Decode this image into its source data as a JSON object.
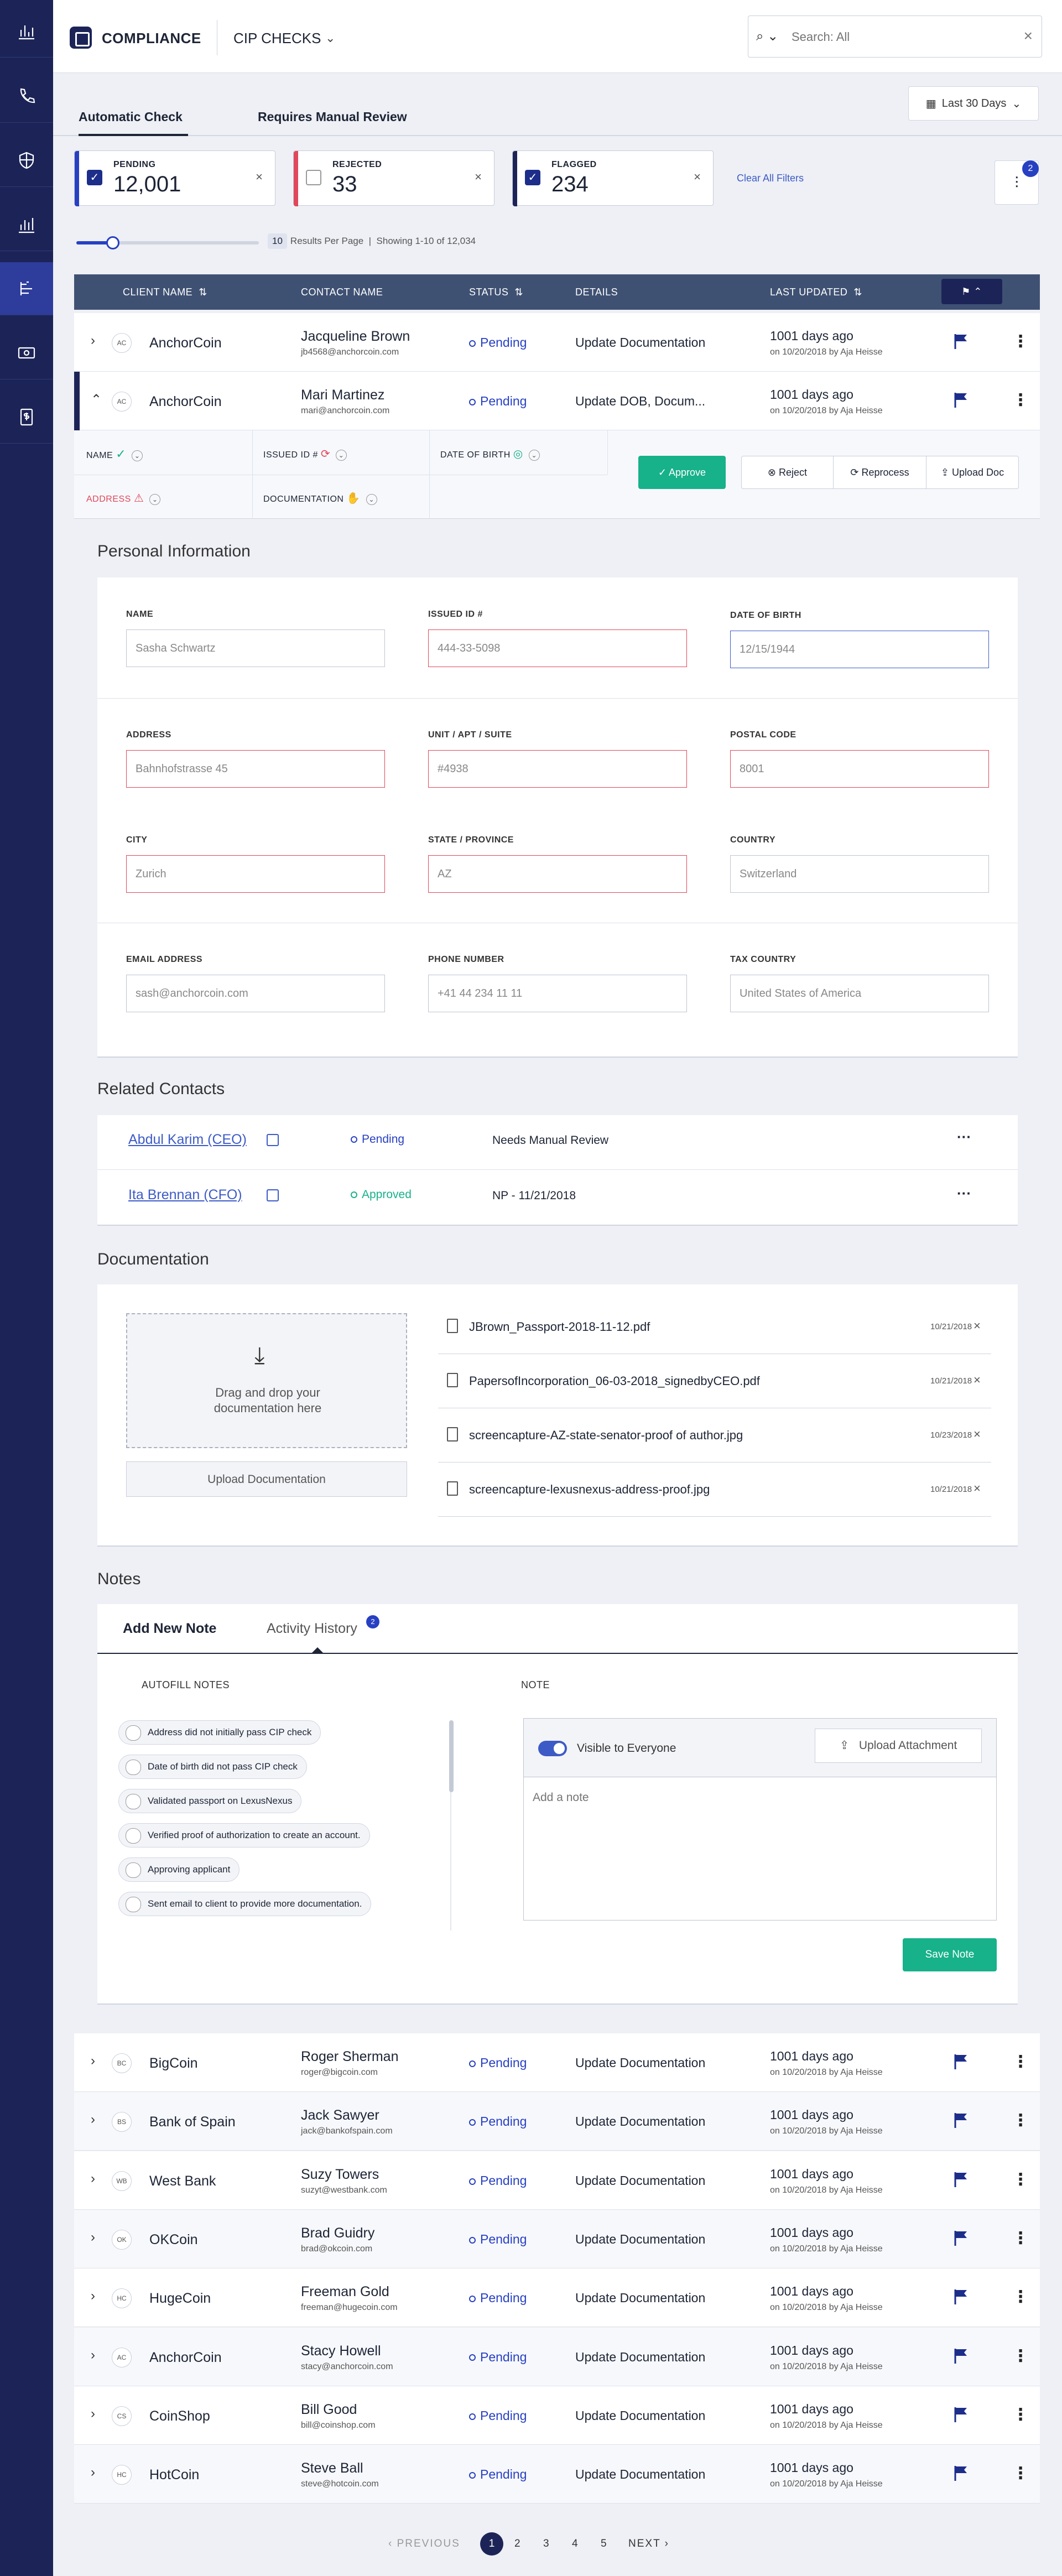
{
  "app": {
    "title": "COMPLIANCE",
    "module": "CIP CHECKS"
  },
  "search": {
    "placeholder": "Search: All"
  },
  "date_range": "Last 30 Days",
  "tabs": [
    {
      "label": "Automatic Check"
    },
    {
      "label": "Requires Manual Review"
    }
  ],
  "filters": [
    {
      "label": "PENDING",
      "count": "12,001",
      "checked": true,
      "color": "#2740c2"
    },
    {
      "label": "REJECTED",
      "count": "33",
      "checked": false,
      "color": "#e0475a"
    },
    {
      "label": "FLAGGED",
      "count": "234",
      "checked": true,
      "color": "#1c2457"
    }
  ],
  "clear_filters": "Clear All Filters",
  "filter_badge": "2",
  "pagination_info": {
    "per_page_value": 0.13,
    "per_page": "10",
    "label": "Results Per Page",
    "showing": "Showing 1-10 of 12,034"
  },
  "columns": {
    "client": "CLIENT NAME",
    "contact": "CONTACT NAME",
    "status": "STATUS",
    "details": "DETAILS",
    "updated": "LAST UPDATED"
  },
  "rows_top": [
    {
      "initials": "AC",
      "client": "AnchorCoin",
      "contact": "Jacqueline Brown",
      "email": "jb4568@anchorcoin.com",
      "status": "Pending",
      "details": "Update Documentation",
      "updated": "1001 days ago",
      "updated_by": "on 10/20/2018 by Aja Heisse"
    },
    {
      "initials": "AC",
      "client": "AnchorCoin",
      "contact": "Mari Martinez",
      "email": "mari@anchorcoin.com",
      "status": "Pending",
      "details": "Update DOB, Docum...",
      "updated": "1001 days ago",
      "updated_by": "on 10/20/2018 by Aja Heisse"
    }
  ],
  "checks": {
    "name": "NAME",
    "issued_id": "ISSUED ID #",
    "dob": "DATE OF BIRTH",
    "address": "ADDRESS",
    "documentation": "DOCUMENTATION",
    "approve": "Approve",
    "reject": "Reject",
    "reprocess": "Reprocess",
    "upload_doc": "Upload Doc"
  },
  "personal_info": {
    "title": "Personal Information",
    "fields": {
      "name": {
        "label": "NAME",
        "value": "Sasha Schwartz"
      },
      "issued_id": {
        "label": "ISSUED ID #",
        "value": "444-33-5098"
      },
      "dob": {
        "label": "DATE OF BIRTH",
        "value": "12/15/1944"
      },
      "address": {
        "label": "ADDRESS",
        "value": "Bahnhofstrasse 45"
      },
      "unit": {
        "label": "UNIT / APT / SUITE",
        "value": "#4938"
      },
      "postal": {
        "label": "POSTAL CODE",
        "value": "8001"
      },
      "city": {
        "label": "CITY",
        "value": "Zurich"
      },
      "state": {
        "label": "STATE / PROVINCE",
        "value": "AZ"
      },
      "country": {
        "label": "COUNTRY",
        "value": "Switzerland"
      },
      "email": {
        "label": "EMAIL ADDRESS",
        "value": "sash@anchorcoin.com"
      },
      "phone": {
        "label": "PHONE NUMBER",
        "value": "+41 44 234 11 11"
      },
      "tax_country": {
        "label": "TAX COUNTRY",
        "value": "United States of America"
      }
    }
  },
  "related_contacts": {
    "title": "Related Contacts",
    "items": [
      {
        "name": "Abdul Karim (CEO)",
        "status": "Pending",
        "note": "Needs Manual Review"
      },
      {
        "name": "Ita Brennan (CFO)",
        "status": "Approved",
        "note": "NP - 11/21/2018"
      }
    ]
  },
  "documentation": {
    "title": "Documentation",
    "drop_text_1": "Drag and drop your",
    "drop_text_2": "documentation here",
    "upload": "Upload Documentation",
    "files": [
      {
        "name": "JBrown_Passport-2018-11-12.pdf",
        "date": "10/21/2018"
      },
      {
        "name": "PapersofIncorporation_06-03-2018_signedbyCEO.pdf",
        "date": "10/21/2018"
      },
      {
        "name": "screencapture-AZ-state-senator-proof of author.jpg",
        "date": "10/23/2018"
      },
      {
        "name": "screencapture-lexusnexus-address-proof.jpg",
        "date": "10/21/2018"
      }
    ]
  },
  "notes": {
    "title": "Notes",
    "tab_add": "Add New Note",
    "tab_history": "Activity History",
    "history_badge": "2",
    "autofill_label": "AUTOFILL NOTES",
    "note_label": "NOTE",
    "autofill": [
      "Address did not initially pass CIP check",
      "Date of birth did not pass CIP check",
      "Validated passport on LexusNexus",
      "Verified proof of authorization to create an account.",
      "Approving applicant",
      "Sent email to client to provide more documentation."
    ],
    "visible_label": "Visible to Everyone",
    "upload_attachment": "Upload Attachment",
    "placeholder": "Add a note",
    "save": "Save Note"
  },
  "rows_bottom": [
    {
      "initials": "BC",
      "client": "BigCoin",
      "contact": "Roger Sherman",
      "email": "roger@bigcoin.com",
      "status": "Pending",
      "details": "Update Documentation",
      "updated": "1001 days ago",
      "updated_by": "on 10/20/2018 by Aja Heisse"
    },
    {
      "initials": "BS",
      "client": "Bank of Spain",
      "contact": "Jack Sawyer",
      "email": "jack@bankofspain.com",
      "status": "Pending",
      "details": "Update Documentation",
      "updated": "1001 days ago",
      "updated_by": "on 10/20/2018 by Aja Heisse"
    },
    {
      "initials": "WB",
      "client": "West Bank",
      "contact": "Suzy Towers",
      "email": "suzyt@westbank.com",
      "status": "Pending",
      "details": "Update Documentation",
      "updated": "1001 days ago",
      "updated_by": "on 10/20/2018 by Aja Heisse"
    },
    {
      "initials": "OK",
      "client": "OKCoin",
      "contact": "Brad Guidry",
      "email": "brad@okcoin.com",
      "status": "Pending",
      "details": "Update Documentation",
      "updated": "1001 days ago",
      "updated_by": "on 10/20/2018 by Aja Heisse"
    },
    {
      "initials": "HC",
      "client": "HugeCoin",
      "contact": "Freeman Gold",
      "email": "freeman@hugecoin.com",
      "status": "Pending",
      "details": "Update Documentation",
      "updated": "1001 days ago",
      "updated_by": "on 10/20/2018 by Aja Heisse"
    },
    {
      "initials": "AC",
      "client": "AnchorCoin",
      "contact": "Stacy Howell",
      "email": "stacy@anchorcoin.com",
      "status": "Pending",
      "details": "Update Documentation",
      "updated": "1001 days ago",
      "updated_by": "on 10/20/2018 by Aja Heisse"
    },
    {
      "initials": "CS",
      "client": "CoinShop",
      "contact": "Bill Good",
      "email": "bill@coinshop.com",
      "status": "Pending",
      "details": "Update Documentation",
      "updated": "1001 days ago",
      "updated_by": "on 10/20/2018 by Aja Heisse"
    },
    {
      "initials": "HC",
      "client": "HotCoin",
      "contact": "Steve Ball",
      "email": "steve@hotcoin.com",
      "status": "Pending",
      "details": "Update Documentation",
      "updated": "1001 days ago",
      "updated_by": "on 10/20/2018 by Aja Heisse"
    }
  ],
  "pager": {
    "prev": "PREVIOUS",
    "next": "NEXT",
    "pages": [
      "1",
      "2",
      "3",
      "4",
      "5"
    ]
  }
}
